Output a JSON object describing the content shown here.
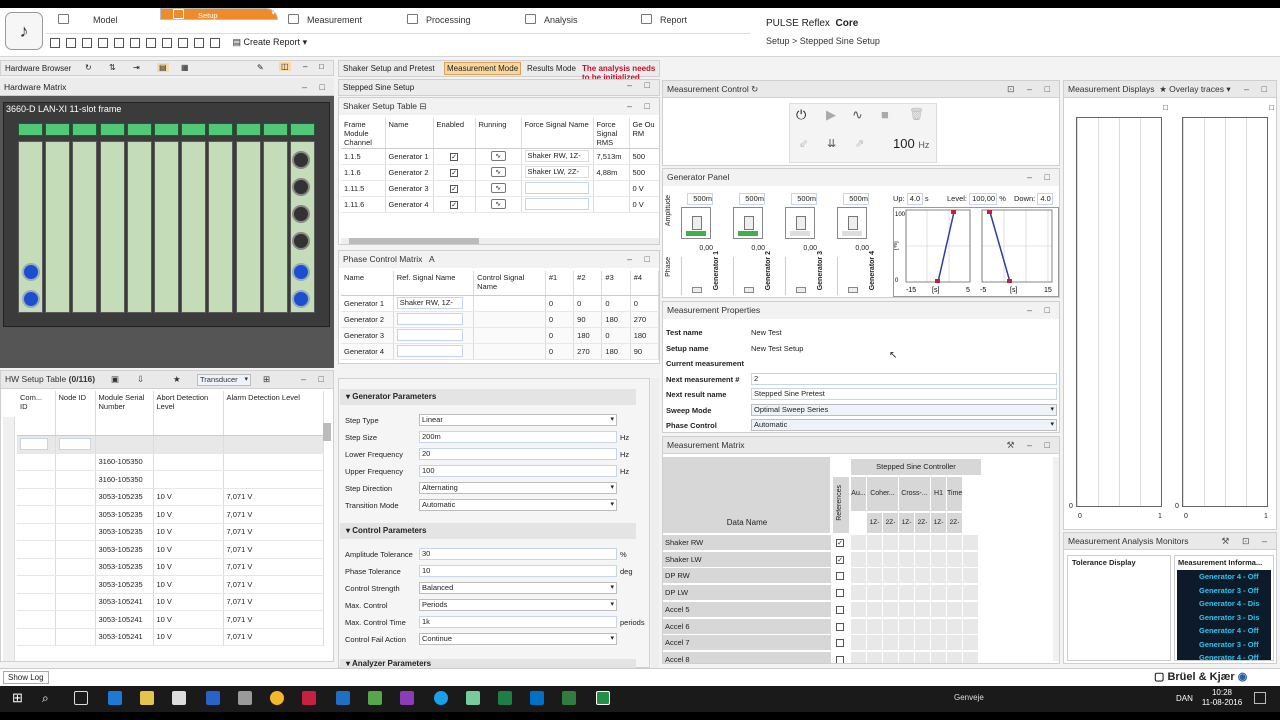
{
  "ribbon": {
    "tabs": [
      {
        "label": "Model",
        "icon": "model-icon"
      },
      {
        "label": "Setup",
        "icon": "setup-icon"
      },
      {
        "label": "Measurement",
        "icon": "measurement-icon"
      },
      {
        "label": "Processing",
        "icon": "processing-icon"
      },
      {
        "label": "Analysis",
        "icon": "analysis-icon"
      },
      {
        "label": "Report",
        "icon": "report-icon"
      }
    ],
    "active_tab": "Setup",
    "create_report": "Create Report",
    "project_name": "PULSE Reflex",
    "project_edition": "Core",
    "breadcrumb": "Setup > Stepped Sine Setup"
  },
  "hardware_browser": {
    "title": "Hardware Browser"
  },
  "hardware_matrix": {
    "title": "Hardware Matrix",
    "frame_title": "3660-D LAN-XI 11-slot frame"
  },
  "hw_setup_table": {
    "title": "HW Setup Table",
    "count": "(0/116)",
    "filter_value": "Transducer",
    "columns": [
      "Com... ID",
      "Node ID",
      "Module Serial Number",
      "Abort Detection Level",
      "Alarm Detection Level"
    ],
    "rows": [
      [
        "",
        "",
        "3160-105350",
        "",
        ""
      ],
      [
        "",
        "",
        "3160-105350",
        "",
        ""
      ],
      [
        "",
        "",
        "3053-105235",
        "10 V",
        "7,071 V"
      ],
      [
        "",
        "",
        "3053-105235",
        "10 V",
        "7,071 V"
      ],
      [
        "",
        "",
        "3053-105235",
        "10 V",
        "7,071 V"
      ],
      [
        "",
        "",
        "3053-105235",
        "10 V",
        "7,071 V"
      ],
      [
        "",
        "",
        "3053-105235",
        "10 V",
        "7,071 V"
      ],
      [
        "",
        "",
        "3053-105235",
        "10 V",
        "7,071 V"
      ],
      [
        "",
        "",
        "3053-105241",
        "10 V",
        "7,071 V"
      ],
      [
        "",
        "",
        "3053-105241",
        "10 V",
        "7,071 V"
      ],
      [
        "",
        "",
        "3053-105241",
        "10 V",
        "7,071 V"
      ]
    ]
  },
  "shaker_setup": {
    "title": "Shaker Setup and Pretest",
    "mode_measurement": "Measurement Mode",
    "mode_results": "Results Mode",
    "warning": "The analysis needs to be initialized",
    "warning_color": "#c8102e"
  },
  "stepped_sine_setup": {
    "title": "Stepped Sine Setup"
  },
  "shaker_setup_table": {
    "title": "Shaker Setup Table",
    "columns": [
      "Frame Module Channel",
      "Name",
      "Enabled",
      "Running",
      "Force Signal Name",
      "Force Signal RMS",
      "Ge Ou RM"
    ],
    "rows": [
      {
        "channel": "1.1.5",
        "name": "Generator 1",
        "enabled": true,
        "signal": "Shaker RW, 1Z-",
        "rms": "7,513m",
        "out": "500"
      },
      {
        "channel": "1.1.6",
        "name": "Generator 2",
        "enabled": true,
        "signal": "Shaker LW, 2Z-",
        "rms": "4,88m",
        "out": "500"
      },
      {
        "channel": "1.11.5",
        "name": "Generator 3",
        "enabled": true,
        "signal": "",
        "rms": "",
        "out": "0 V"
      },
      {
        "channel": "1.11.6",
        "name": "Generator 4",
        "enabled": true,
        "signal": "",
        "rms": "",
        "out": "0 V"
      }
    ]
  },
  "phase_control_matrix": {
    "title": "Phase Control Matrix",
    "title_suffix": "A",
    "columns": [
      "Name",
      "Ref. Signal Name",
      "Control Signal Name",
      "#1",
      "#2",
      "#3",
      "#4"
    ],
    "rows": [
      {
        "name": "Generator 1",
        "ref": "Shaker RW, 1Z-",
        "ctrl": "",
        "v": [
          "0",
          "0",
          "0",
          "0"
        ]
      },
      {
        "name": "Generator 2",
        "ref": "",
        "ctrl": "",
        "v": [
          "0",
          "90",
          "180",
          "270"
        ]
      },
      {
        "name": "Generator 3",
        "ref": "",
        "ctrl": "",
        "v": [
          "0",
          "180",
          "0",
          "180"
        ]
      },
      {
        "name": "Generator 4",
        "ref": "",
        "ctrl": "",
        "v": [
          "0",
          "270",
          "180",
          "90"
        ]
      }
    ]
  },
  "generator_parameters": {
    "title": "Generator Parameters",
    "fields": [
      {
        "label": "Step Type",
        "value": "Linear",
        "type": "select",
        "unit": ""
      },
      {
        "label": "Step Size",
        "value": "200m",
        "type": "input",
        "unit": "Hz"
      },
      {
        "label": "Lower Frequency",
        "value": "20",
        "type": "input",
        "unit": "Hz"
      },
      {
        "label": "Upper Frequency",
        "value": "100",
        "type": "input",
        "unit": "Hz"
      },
      {
        "label": "Step Direction",
        "value": "Alternating",
        "type": "select",
        "unit": ""
      },
      {
        "label": "Transition Mode",
        "value": "Automatic",
        "type": "select",
        "unit": ""
      }
    ]
  },
  "control_parameters": {
    "title": "Control Parameters",
    "fields": [
      {
        "label": "Amplitude Tolerance",
        "value": "30",
        "type": "input",
        "unit": "%"
      },
      {
        "label": "Phase Tolerance",
        "value": "10",
        "type": "input",
        "unit": "deg"
      },
      {
        "label": "Control Strength",
        "value": "Balanced",
        "type": "select",
        "unit": ""
      },
      {
        "label": "Max. Control",
        "value": "Periods",
        "type": "select",
        "unit": ""
      },
      {
        "label": "Max. Control Time",
        "value": "1k",
        "type": "input",
        "unit": "periods"
      },
      {
        "label": "Control Fail Action",
        "value": "Continue",
        "type": "select",
        "unit": ""
      }
    ]
  },
  "analyzer_parameters": {
    "title": "Analyzer Parameters"
  },
  "measurement_control": {
    "title": "Measurement Control",
    "frequency_value": "100",
    "frequency_unit": "Hz"
  },
  "generator_panel": {
    "title": "Generator Panel",
    "amplitude_label": "Amplitude",
    "phase_label": "Phase",
    "generators": [
      {
        "name": "Generator 1",
        "max": "500m",
        "value": "0,00"
      },
      {
        "name": "Generator 2",
        "max": "500m",
        "value": "0,00"
      },
      {
        "name": "Generator 3",
        "max": "500m",
        "value": "0,00"
      },
      {
        "name": "Generator 4",
        "max": "500m",
        "value": "0,00"
      }
    ],
    "up_label": "Up:",
    "up_value": "4.0",
    "up_unit": "s",
    "level_label": "Level:",
    "level_value": "100,00",
    "level_unit": "%",
    "down_label": "Down:",
    "down_value": "4.0",
    "down_unit": "s",
    "ramp_chart": {
      "ylabel": "[%]",
      "ytick_top": "100",
      "ytick_bottom": "0",
      "x_left": "-15",
      "x_mid": "[s]",
      "x_right": "5"
    },
    "ramp_chart2": {
      "x_left": "-5",
      "x_mid": "[s]",
      "x_right": "15"
    }
  },
  "measurement_properties": {
    "title": "Measurement Properties",
    "rows": [
      {
        "label": "Test name",
        "value": "New Test",
        "type": "text"
      },
      {
        "label": "Setup name",
        "value": "New Test Setup",
        "type": "text"
      },
      {
        "label": "Current measurement",
        "value": "",
        "type": "text"
      },
      {
        "label": "Next measurement #",
        "value": "2",
        "type": "input"
      },
      {
        "label": "Next result name",
        "value": "Stepped Sine Pretest",
        "type": "input"
      },
      {
        "label": "Sweep Mode",
        "value": "Optimal Sweep Series",
        "type": "select"
      },
      {
        "label": "Phase Control",
        "value": "Automatic",
        "type": "select"
      }
    ]
  },
  "measurement_matrix": {
    "title": "Measurement Matrix",
    "group_header": "Stepped Sine Controller",
    "references_label": "References",
    "data_name_label": "Data Name",
    "sub_columns": [
      "Au...",
      "Coher...",
      "Cross-...",
      "H1",
      "Time..."
    ],
    "sub_sub": [
      "1Z-",
      "2Z-",
      "1Z-",
      "2Z-",
      "1Z-",
      "2Z-"
    ],
    "rows": [
      {
        "name": "Shaker RW",
        "ref": true
      },
      {
        "name": "Shaker LW",
        "ref": true
      },
      {
        "name": "DP RW",
        "ref": false
      },
      {
        "name": "DP LW",
        "ref": false
      },
      {
        "name": "Accel 5",
        "ref": false
      },
      {
        "name": "Accel 6",
        "ref": false
      },
      {
        "name": "Accel 7",
        "ref": false
      },
      {
        "name": "Accel 8",
        "ref": false
      }
    ]
  },
  "measurement_displays": {
    "title": "Measurement Displays",
    "overlay_label": "Overlay traces",
    "axis_x_left": "0",
    "axis_x_right": "1",
    "axis_y_bottom": "0"
  },
  "analysis_monitors": {
    "title": "Measurement Analysis Monitors",
    "tolerance_title": "Tolerance Display",
    "info_title": "Measurement Informa...",
    "info_lines": [
      "Generator 4 - Off",
      "Generator 3 - Off",
      "Generator 4 - Dis",
      "Generator 3 - Dis",
      "Generator 4 - Off",
      "Generator 3 - Off",
      "Generator 4 - Off"
    ]
  },
  "status": {
    "show_log": "Show Log",
    "brand": "Brüel & Kjær"
  },
  "taskbar": {
    "lang": "DAN",
    "time": "10:28",
    "date": "11-08-2016",
    "genveje": "Genveje"
  }
}
